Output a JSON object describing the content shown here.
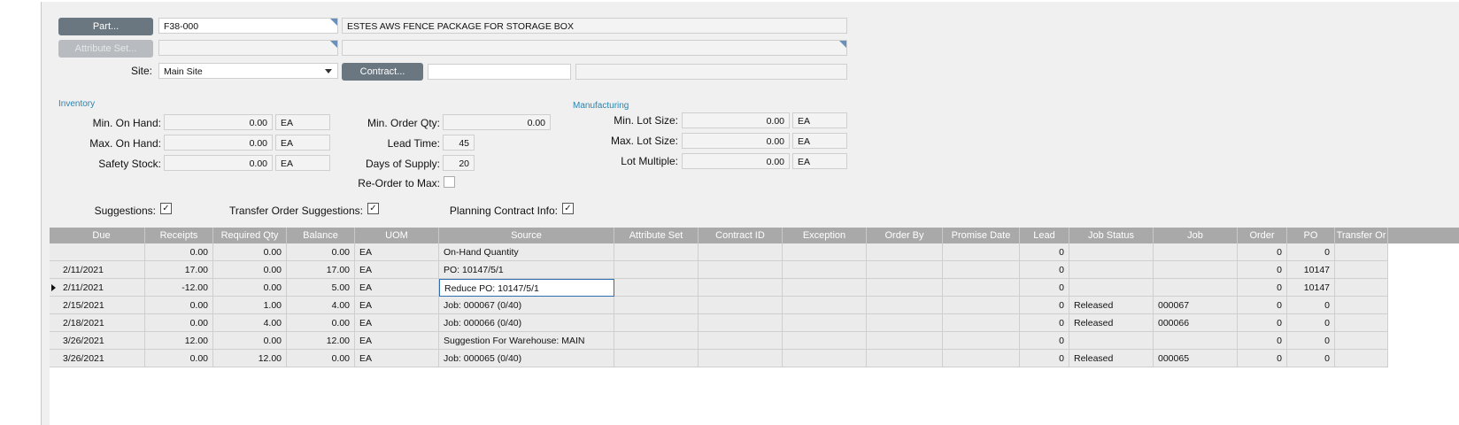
{
  "header": {
    "part_button": "Part...",
    "part_value": "F38-000",
    "part_description": "ESTES AWS FENCE PACKAGE FOR STORAGE BOX",
    "attribute_set_button": "Attribute Set...",
    "attribute_set_value": "",
    "attribute_set_description": "",
    "site_label": "Site:",
    "site_value": "Main Site",
    "contract_button": "Contract...",
    "contract_value": "",
    "contract_description": ""
  },
  "inventory": {
    "section_label": "Inventory",
    "min_on_hand_label": "Min. On Hand:",
    "min_on_hand_value": "0.00",
    "min_on_hand_uom": "EA",
    "max_on_hand_label": "Max. On Hand:",
    "max_on_hand_value": "0.00",
    "max_on_hand_uom": "EA",
    "safety_stock_label": "Safety Stock:",
    "safety_stock_value": "0.00",
    "safety_stock_uom": "EA"
  },
  "ordering": {
    "min_order_qty_label": "Min. Order Qty:",
    "min_order_qty_value": "0.00",
    "lead_time_label": "Lead Time:",
    "lead_time_value": "45",
    "days_of_supply_label": "Days of Supply:",
    "days_of_supply_value": "20",
    "reorder_to_max_label": "Re-Order to Max:",
    "reorder_to_max_checked": false
  },
  "manufacturing": {
    "section_label": "Manufacturing",
    "min_lot_label": "Min. Lot Size:",
    "min_lot_value": "0.00",
    "min_lot_uom": "EA",
    "max_lot_label": "Max. Lot Size:",
    "max_lot_value": "0.00",
    "max_lot_uom": "EA",
    "lot_multiple_label": "Lot Multiple:",
    "lot_multiple_value": "0.00",
    "lot_multiple_uom": "EA"
  },
  "options": {
    "suggestions_label": "Suggestions:",
    "suggestions_checked": true,
    "transfer_label": "Transfer Order Suggestions:",
    "transfer_checked": true,
    "planning_label": "Planning Contract Info:",
    "planning_checked": true,
    "check_glyph": "✓"
  },
  "grid": {
    "columns": [
      "Due",
      "Receipts",
      "Required Qty",
      "Balance",
      "UOM",
      "Source",
      "Attribute Set",
      "Contract ID",
      "Exception",
      "Order By",
      "Promise Date",
      "Lead",
      "Job Status",
      "Job",
      "Order",
      "PO",
      "Transfer Or"
    ],
    "rows": [
      [
        "",
        "0.00",
        "0.00",
        "0.00",
        "EA",
        "On-Hand Quantity",
        "",
        "",
        "",
        "",
        "",
        "0",
        "",
        "",
        "0",
        "0",
        ""
      ],
      [
        "2/11/2021",
        "17.00",
        "0.00",
        "17.00",
        "EA",
        "PO: 10147/5/1",
        "",
        "",
        "",
        "",
        "",
        "0",
        "",
        "",
        "0",
        "10147",
        ""
      ],
      [
        "2/11/2021",
        "-12.00",
        "0.00",
        "5.00",
        "EA",
        "Reduce PO: 10147/5/1",
        "",
        "",
        "",
        "",
        "",
        "0",
        "",
        "",
        "0",
        "10147",
        ""
      ],
      [
        "2/15/2021",
        "0.00",
        "1.00",
        "4.00",
        "EA",
        "Job: 000067 (0/40)",
        "",
        "",
        "",
        "",
        "",
        "0",
        "Released",
        "000067",
        "0",
        "0",
        ""
      ],
      [
        "2/18/2021",
        "0.00",
        "4.00",
        "0.00",
        "EA",
        "Job: 000066 (0/40)",
        "",
        "",
        "",
        "",
        "",
        "0",
        "Released",
        "000066",
        "0",
        "0",
        ""
      ],
      [
        "3/26/2021",
        "12.00",
        "0.00",
        "12.00",
        "EA",
        "Suggestion For Warehouse: MAIN",
        "",
        "",
        "",
        "",
        "",
        "0",
        "",
        "",
        "0",
        "0",
        ""
      ],
      [
        "3/26/2021",
        "0.00",
        "12.00",
        "0.00",
        "EA",
        "Job: 000065 (0/40)",
        "",
        "",
        "",
        "",
        "",
        "0",
        "Released",
        "000065",
        "0",
        "0",
        ""
      ]
    ],
    "selected_row": 2
  }
}
